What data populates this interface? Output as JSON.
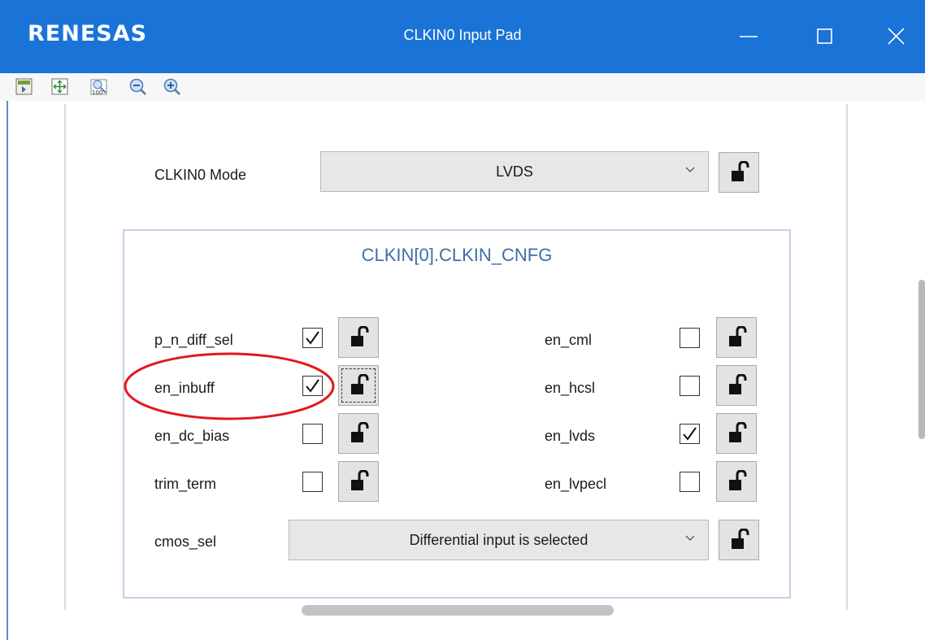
{
  "window": {
    "logo_text": "RENESAS",
    "title": "CLKIN0 Input Pad",
    "minimize_label": "—",
    "maximize_label": "☐",
    "close_label": "✕"
  },
  "toolbar": {
    "icons": [
      "export-icon",
      "fit-to-screen-icon",
      "zoom-100-icon",
      "zoom-out-icon",
      "zoom-in-icon"
    ]
  },
  "mode": {
    "label": "CLKIN0 Mode",
    "value": "LVDS"
  },
  "group": {
    "title": "CLKIN[0].CLKIN_CNFG"
  },
  "left_fields": [
    {
      "label": "p_n_diff_sel",
      "checked": true
    },
    {
      "label": "en_inbuff",
      "checked": true
    },
    {
      "label": "en_dc_bias",
      "checked": false
    },
    {
      "label": "trim_term",
      "checked": false
    }
  ],
  "right_fields": [
    {
      "label": "en_cml",
      "checked": false
    },
    {
      "label": "en_hcsl",
      "checked": false
    },
    {
      "label": "en_lvds",
      "checked": true
    },
    {
      "label": "en_lvpecl",
      "checked": false
    }
  ],
  "cmos_sel": {
    "label": "cmos_sel",
    "value": "Differential input is selected"
  },
  "colors": {
    "titlebar": "#1a73d6",
    "group_title": "#3f6ea6",
    "annotation": "#e0191c"
  }
}
